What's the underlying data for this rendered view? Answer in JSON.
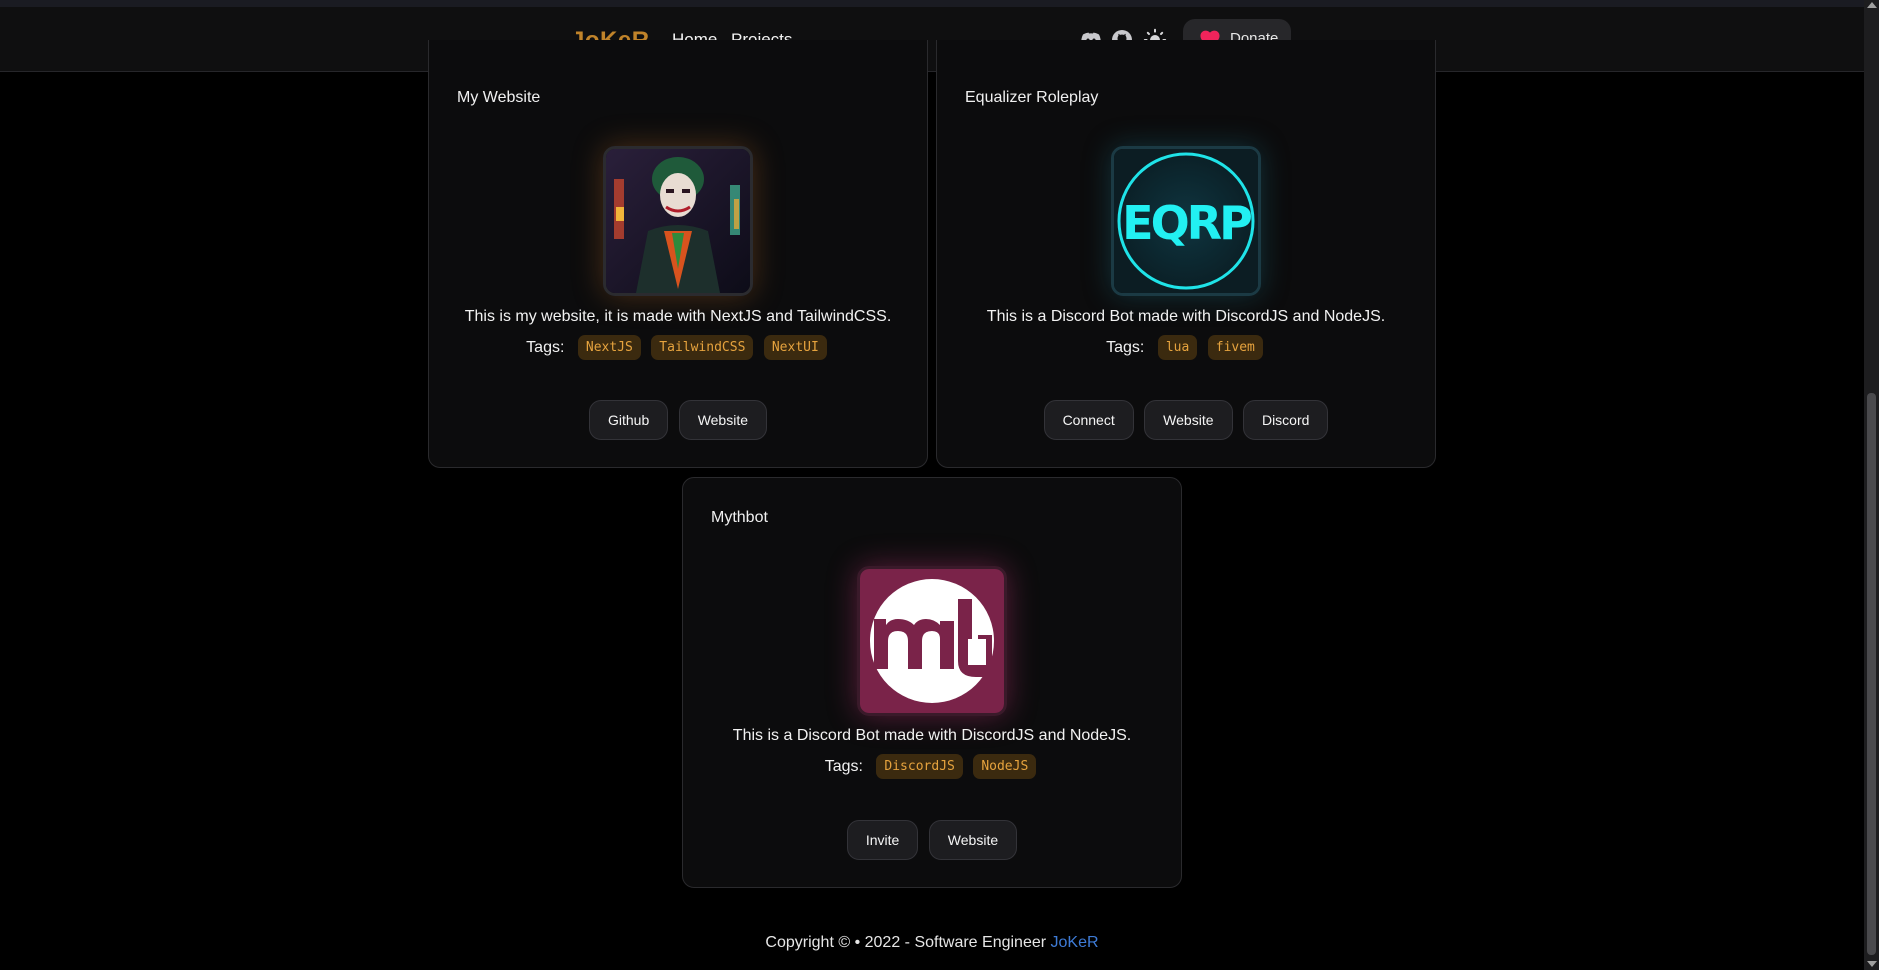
{
  "nav": {
    "brand": "JoKeR",
    "links": [
      "Home",
      "Projects"
    ],
    "icons": [
      "discord-icon",
      "github-icon",
      "sun-icon"
    ],
    "donate_label": "Donate",
    "brand_color": "#c0832a",
    "heart_color": "#f0245b"
  },
  "projects": [
    {
      "title": "My Website",
      "description": "This is my website, it is made with NextJS and TailwindCSS.",
      "tags_label": "Tags:",
      "tags": [
        "NextJS",
        "TailwindCSS",
        "NextUI"
      ],
      "buttons": [
        "Github",
        "Website"
      ]
    },
    {
      "title": "Equalizer Roleplay",
      "logo_text": "EQRP",
      "description": "This is a Discord Bot made with DiscordJS and NodeJS.",
      "tags_label": "Tags:",
      "tags": [
        "lua",
        "fivem"
      ],
      "buttons": [
        "Connect",
        "Website",
        "Discord"
      ]
    },
    {
      "title": "Mythbot",
      "description": "This is a Discord Bot made with DiscordJS and NodeJS.",
      "tags_label": "Tags:",
      "tags": [
        "DiscordJS",
        "NodeJS"
      ],
      "buttons": [
        "Invite",
        "Website"
      ]
    }
  ],
  "footer": {
    "text": "Copyright © • 2022 - Software Engineer",
    "link": "JoKeR",
    "link_color": "#3e7bd6"
  },
  "theme": {
    "tag_bg": "#3b2a0f",
    "tag_text": "#e6a33e"
  }
}
